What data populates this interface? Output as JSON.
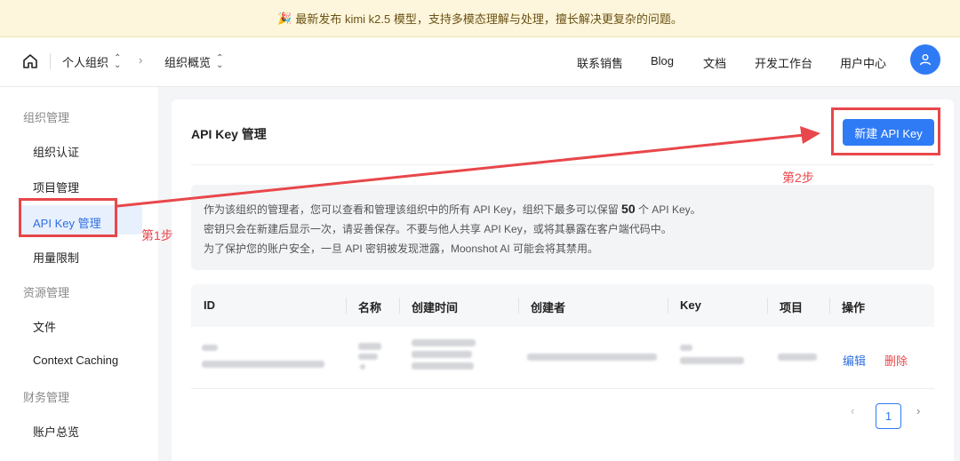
{
  "banner": {
    "icon": "party-popper-icon",
    "text": "最新发布 kimi k2.5 模型，支持多模态理解与处理，擅长解决更复杂的问题。"
  },
  "topbar": {
    "breadcrumb": [
      "个人组织",
      "组织概览"
    ],
    "nav": [
      "联系销售",
      "Blog",
      "文档",
      "开发工作台",
      "用户中心"
    ]
  },
  "sidebar": {
    "sections": [
      {
        "title": "组织管理",
        "items": [
          "组织认证",
          "项目管理",
          "API Key 管理",
          "用量限制"
        ]
      },
      {
        "title": "资源管理",
        "items": [
          "文件",
          "Context Caching"
        ]
      },
      {
        "title": "财务管理",
        "items": [
          "账户总览"
        ]
      }
    ],
    "active_item": "API Key 管理"
  },
  "main": {
    "title": "API Key 管理",
    "new_button": "新建 API Key",
    "info": {
      "line1_prefix": "作为该组织的管理者，您可以查看和管理该组织中的所有 API Key，组织下最多可以保留",
      "line1_count": "50",
      "line1_suffix": "个 API Key。",
      "line2": "密钥只会在新建后显示一次，请妥善保存。不要与他人共享 API Key，或将其暴露在客户端代码中。",
      "line3": "为了保护您的账户安全，一旦 API 密钥被发现泄露，Moonshot AI 可能会将其禁用。"
    },
    "table": {
      "columns": [
        "ID",
        "名称",
        "创建时间",
        "创建者",
        "Key",
        "项目",
        "操作"
      ],
      "row_actions": {
        "edit": "编辑",
        "delete": "删除"
      }
    },
    "pagination": {
      "prev": "‹",
      "current": "1",
      "next": "›"
    }
  },
  "annotations": {
    "step1": "第1步",
    "step2": "第2步",
    "color": "#e8474b"
  },
  "colors": {
    "primary": "#2f7bf5",
    "danger": "#e8474b",
    "banner_bg": "#fdf6dc"
  }
}
